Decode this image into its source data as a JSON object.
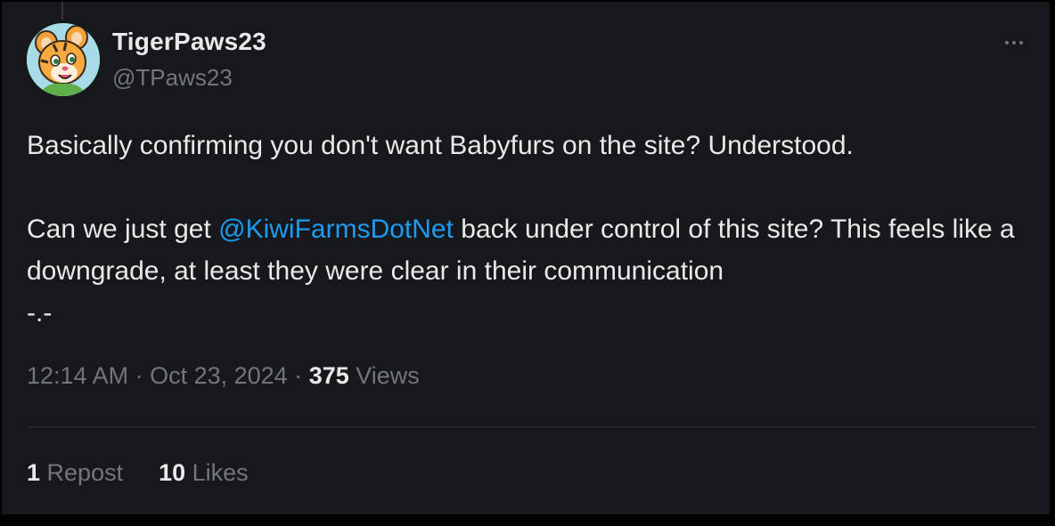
{
  "tweet": {
    "display_name": "TigerPaws23",
    "handle": "@TPaws23",
    "text_line1": "Basically confirming you don't want Babyfurs on the site? Understood.",
    "text_line2_before": "Can we just get ",
    "mention": "@KiwiFarmsDotNet",
    "text_line2_after": " back under control of this site? This feels like a downgrade, at least they were clear in their communication",
    "text_line3": "-.-",
    "time": "12:14 AM",
    "separator": " · ",
    "date": "Oct 23, 2024",
    "views_count": "375",
    "views_label": " Views",
    "reposts_count": "1",
    "reposts_label": " Repost",
    "likes_count": "10",
    "likes_label": " Likes"
  },
  "icons": {
    "more": "more-dots-icon",
    "avatar": "tiger-avatar-image"
  },
  "colors": {
    "background": "#16181c",
    "text_primary": "#e7e9ea",
    "text_secondary": "#71767b",
    "link": "#1d9bf0",
    "divider": "#2f3336"
  }
}
